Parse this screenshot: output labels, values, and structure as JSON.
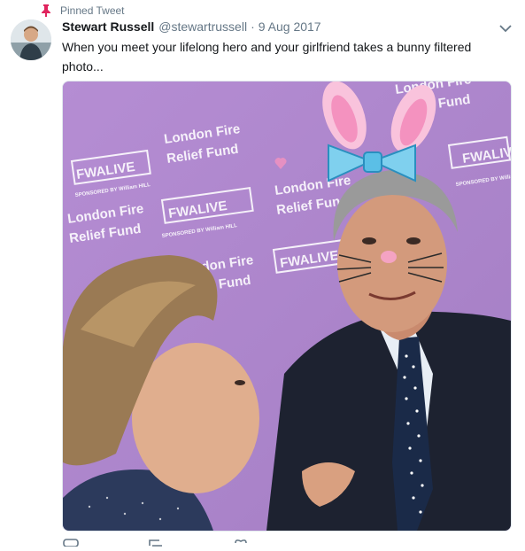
{
  "pinned_label": "Pinned Tweet",
  "author": {
    "fullname": "Stewart Russell",
    "username": "@stewartrussell",
    "date": "9 Aug 2017"
  },
  "separator": "·",
  "tweet_text": "When you meet your lifelong hero and your girlfriend takes a bunny filtered photo...",
  "photo": {
    "backdrop_text": [
      "London Fire",
      "Relief Fund",
      "FWALIVE",
      "SPONSORED BY William HILL"
    ]
  },
  "colors": {
    "pin": "#e0245e",
    "secondary_text": "#657786",
    "backdrop": "#b38bd0"
  }
}
